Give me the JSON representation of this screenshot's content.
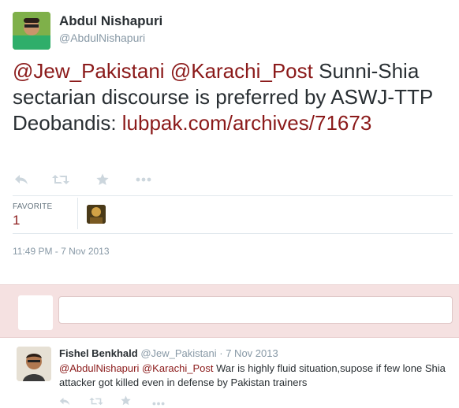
{
  "tweet": {
    "author_name": "Abdul Nishapuri",
    "author_handle": "@AbdulNishapuri",
    "mention_1": "@Jew_Pakistani",
    "mention_2": "@Karachi_Post",
    "text_body": " Sunni-Shia sectarian discourse is preferred by ASWJ-TTP Deobandis: ",
    "link": "lubpak.com/archives/71673",
    "favorite_label": "FAVORITE",
    "favorite_count": "1",
    "timestamp": "11:49 PM - 7 Nov 2013",
    "actions": [
      "reply-icon",
      "retweet-icon",
      "favorite-icon",
      "more-icon"
    ]
  },
  "reply_box": {
    "placeholder": ""
  },
  "reply_tweet": {
    "author_name": "Fishel Benkhald",
    "author_handle": "@Jew_Pakistani",
    "separator": "·",
    "time": "7 Nov 2013",
    "mention_1": "@AbdulNishapuri",
    "mention_2": "@Karachi_Post",
    "text_body": " War is highly fluid situation,supose if few lone Shia attacker got killed even in defense by Pakistan trainers"
  },
  "colors": {
    "link": "#8b1a1a",
    "muted": "#8899a6",
    "reply_bg": "#f5e1e1"
  }
}
